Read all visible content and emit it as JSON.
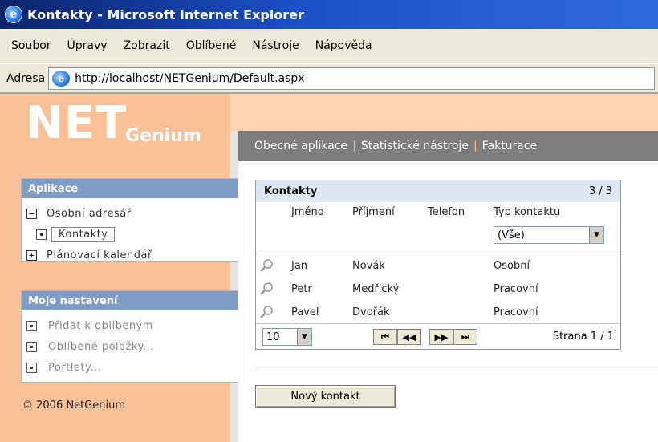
{
  "window": {
    "title": "Kontakty - Microsoft Internet Explorer"
  },
  "menu": [
    "Soubor",
    "Úpravy",
    "Zobrazit",
    "Oblíbené",
    "Nástroje",
    "Nápověda"
  ],
  "address": {
    "label": "Adresa",
    "url": "http://localhost/NETGenium/Default.aspx"
  },
  "logo": {
    "net": "NET",
    "genium": "Genium"
  },
  "nav": {
    "items": [
      "Obecné aplikace",
      "Statistické nástroje",
      "Fakturace"
    ],
    "separator": "|"
  },
  "sidebar": {
    "apps": {
      "title": "Aplikace",
      "items": [
        {
          "label": "Osobní adresář",
          "toggle": "−"
        },
        {
          "label": "Kontakty"
        },
        {
          "label": "Plánovací kalendář",
          "toggle": "+"
        }
      ]
    },
    "settings": {
      "title": "Moje nastavení",
      "items": [
        "Přidat k oblíbeným",
        "Oblíbené položky...",
        "Portlety..."
      ]
    },
    "copyright": "© 2006 NetGenium"
  },
  "grid": {
    "title": "Kontakty",
    "count": "3 / 3",
    "columns": [
      "Jméno",
      "Příjmení",
      "Telefon",
      "Typ kontaktu"
    ],
    "filter_value": "(Vše)",
    "rows": [
      {
        "first": "Jan",
        "last": "Novák",
        "phone": "",
        "type": "Osobní"
      },
      {
        "first": "Petr",
        "last": "Medřický",
        "phone": "",
        "type": "Pracovní"
      },
      {
        "first": "Pavel",
        "last": "Dvořák",
        "phone": "",
        "type": "Pracovní"
      }
    ],
    "page_size": "10",
    "pager_buttons": [
      "⏮",
      "◀◀",
      "▶▶",
      "⏭"
    ],
    "page_info": "Strana 1 / 1"
  },
  "new_button": "Nový kontakt"
}
